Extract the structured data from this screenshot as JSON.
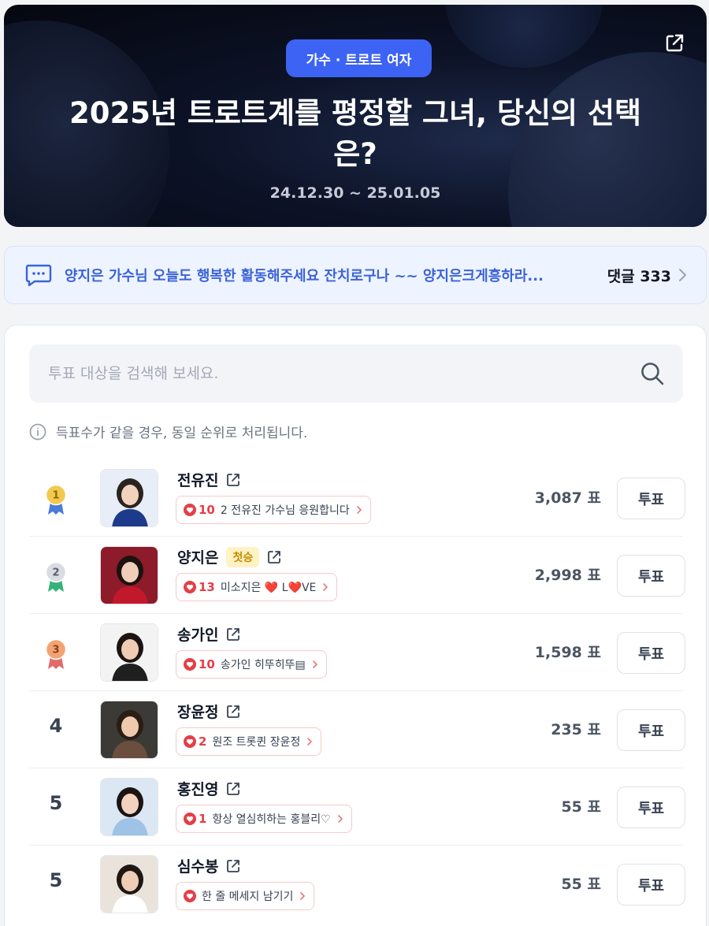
{
  "banner": {
    "category": "가수 · 트로트 여자",
    "title": "2025년 트로트계를 평정할 그녀, 당신의 선택은?",
    "period": "24.12.30 ~ 25.01.05",
    "share_icon": "share-icon"
  },
  "comment_bar": {
    "icon": "chat-icon",
    "text": "양지은 가수님 오늘도 행복한 활동해주세요 잔치로구나 ~~ 양지은크게흥하라...",
    "count_label": "댓글 333"
  },
  "search": {
    "placeholder": "투표 대상을 검색해 보세요.",
    "icon": "search-icon"
  },
  "notice": {
    "text": "득표수가 같을 경우, 동일 순위로 처리됩니다."
  },
  "vote_button_label": "투표",
  "rankings": [
    {
      "rank": "1",
      "medal": "gold",
      "name": "전유진",
      "badge": "",
      "cheer_count": "10",
      "cheer_text": "2 전유진 가수님 응원합니다",
      "votes": "3,087 표"
    },
    {
      "rank": "2",
      "medal": "silver",
      "name": "양지은",
      "badge": "첫승",
      "cheer_count": "13",
      "cheer_text": "미소지은 ❤️ L❤️VE",
      "votes": "2,998 표"
    },
    {
      "rank": "3",
      "medal": "bronze",
      "name": "송가인",
      "badge": "",
      "cheer_count": "10",
      "cheer_text": "송가인 히뚜히뚜▤",
      "votes": "1,598 표"
    },
    {
      "rank": "4",
      "medal": "",
      "name": "장윤정",
      "badge": "",
      "cheer_count": "2",
      "cheer_text": "원조 트롯퀸 장윤정",
      "votes": "235 표"
    },
    {
      "rank": "5",
      "medal": "",
      "name": "홍진영",
      "badge": "",
      "cheer_count": "1",
      "cheer_text": "항상 열심히하는 홍블리♡",
      "votes": "55 표"
    },
    {
      "rank": "5",
      "medal": "",
      "name": "심수봉",
      "badge": "",
      "cheer_count": "",
      "cheer_text": "한 줄 메세지 남기기",
      "votes": "55 표"
    }
  ],
  "colors": {
    "accent": "#3d63f4",
    "gold": "#f2c94c",
    "silver": "#d9dde3",
    "bronze": "#f2a374",
    "heart": "#e53e47"
  }
}
